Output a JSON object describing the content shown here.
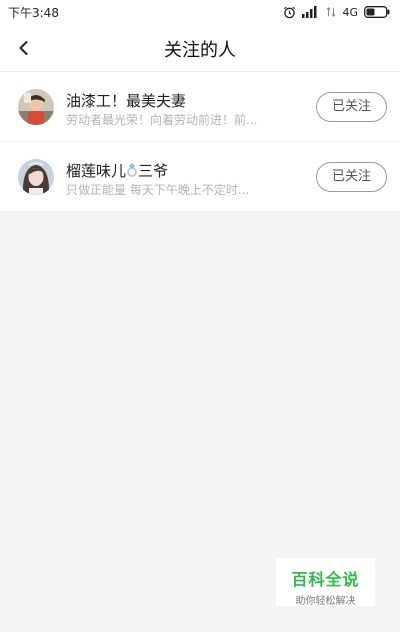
{
  "status_bar": {
    "time": "下午3:48",
    "network": "4G"
  },
  "header": {
    "title": "关注的人"
  },
  "follow_list": [
    {
      "name": "油漆工！最美夫妻",
      "description": "劳动者最光荣！向着劳动前进！前...",
      "button_label": "已关注"
    },
    {
      "name_before_icon": "榴莲味儿",
      "name_after_icon": "三爷",
      "description": "只做正能量 每天下午晚上不定时...",
      "button_label": "已关注"
    }
  ],
  "watermark": {
    "title": "百科全说",
    "subtitle": "助你轻松解决"
  },
  "icons": {
    "back": "chevron-left-icon",
    "alarm": "alarm-clock-icon",
    "signal": "signal-bars-icon",
    "battery": "battery-icon",
    "ring": "diamond-ring-icon"
  },
  "colors": {
    "watermark_green": "#2dbb4a",
    "button_border": "#9a9a9a",
    "description_gray": "#b3b3b3",
    "background": "#f4f4f4"
  }
}
